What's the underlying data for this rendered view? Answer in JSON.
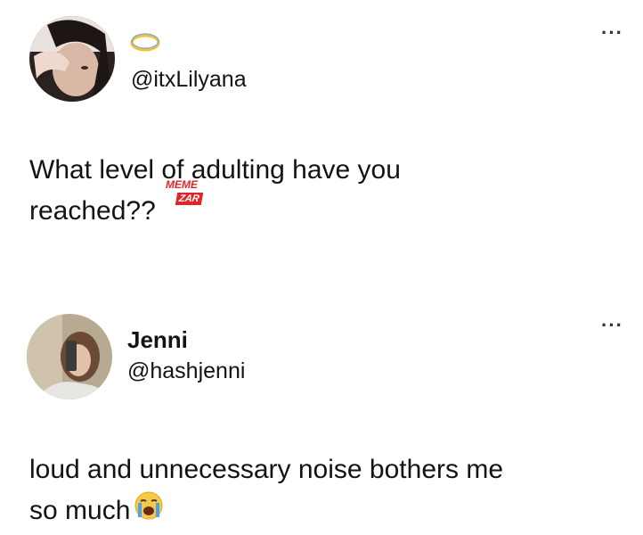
{
  "post1": {
    "handle": "@itxLilyana",
    "text_line1": "What level of adulting have you",
    "text_line2": "reached??",
    "more_label": "···",
    "halo_icon": "halo-icon",
    "watermark": {
      "top": "MEME",
      "box": "ZAR"
    }
  },
  "post2": {
    "name": "Jenni",
    "handle": "@hashjenni",
    "text_line1": "loud and unnecessary noise bothers me",
    "text_line2": "so much",
    "more_label": "···",
    "emoji": "loudly-crying-face"
  }
}
